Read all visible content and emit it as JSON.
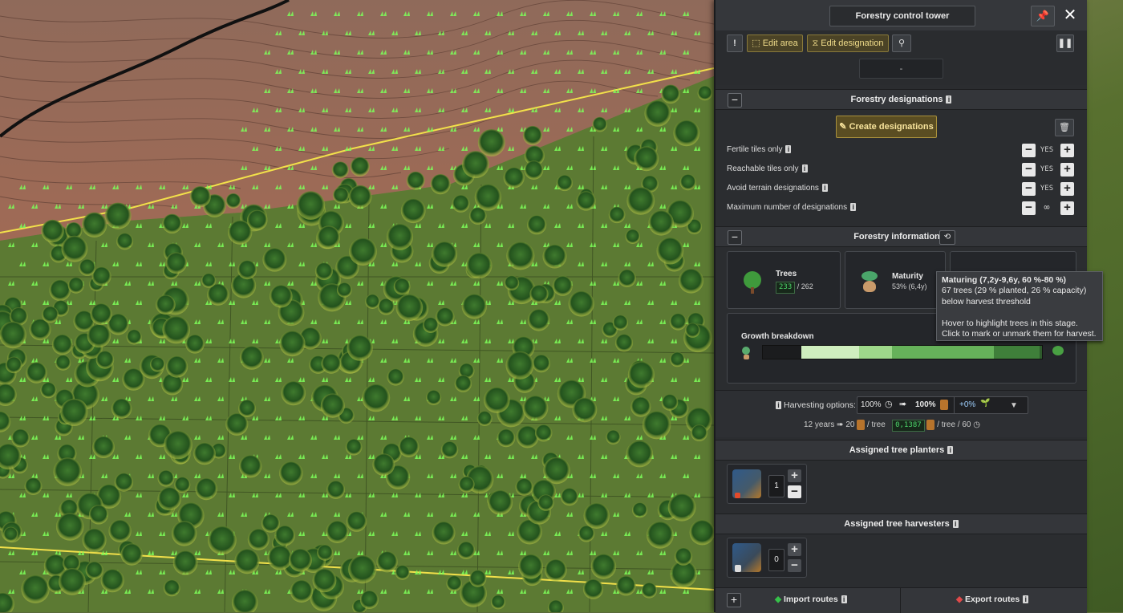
{
  "panel": {
    "title": "Forestry control tower",
    "pin_icon": "pin-icon",
    "close_icon": "close-icon",
    "toolbar": {
      "edit_area_label": "Edit area",
      "edit_designation_label": "Edit designation",
      "selector_value": "-"
    },
    "designations": {
      "title": "Forestry designations",
      "create_label": "Create designations",
      "options": [
        {
          "label": "Fertile tiles only",
          "value": "YES"
        },
        {
          "label": "Reachable tiles only",
          "value": "YES"
        },
        {
          "label": "Avoid terrain designations",
          "value": "YES"
        },
        {
          "label": "Maximum number of designations",
          "value": "∞"
        }
      ]
    },
    "information": {
      "title": "Forestry information",
      "trees_label": "Trees",
      "trees_count": "233",
      "trees_max": "/ 262",
      "maturity_label": "Maturity",
      "maturity_value": "53% (6,4y)",
      "growth_label": "Growth breakdown",
      "growth_segments": [
        {
          "fraction": 0.138,
          "color": "#1b1c1e"
        },
        {
          "fraction": 0.208,
          "color": "#cfeebe"
        },
        {
          "fraction": 0.116,
          "color": "#9ed88a"
        },
        {
          "fraction": 0.365,
          "color": "#66b25a"
        },
        {
          "fraction": 0.165,
          "color": "#3f7f3a"
        },
        {
          "fraction": 0.008,
          "color": "#2e5a2c"
        },
        {
          "fraction": 0.0,
          "color": "#6b3b22"
        }
      ]
    },
    "tooltip": {
      "title": "Maturing (7,2y-9,6y, 60 %-80 %)",
      "line1": "67 trees (29 % planted, 26 % capacity)",
      "line2": "below harvest threshold",
      "line3": "Hover to highlight trees in this stage.",
      "line4": "Click to mark or unmark them for harvest."
    },
    "harvesting": {
      "label": "Harvesting options:",
      "pct1": "100%",
      "pct2": "100%",
      "bonus": "+0%",
      "years": "12 years",
      "per_tree": "20",
      "per_tree_suffix": "/ tree",
      "rate": "0,1387",
      "rate_suffix": "/ tree / 60"
    },
    "planters": {
      "title": "Assigned tree planters",
      "count": "1"
    },
    "harvesters": {
      "title": "Assigned tree harvesters",
      "count": "0"
    },
    "footer": {
      "import_label": "Import routes",
      "export_label": "Export routes"
    }
  },
  "colors": {
    "accent_gold": "#f0dc8a",
    "panel_bg": "#2b2d30",
    "lcd_green": "#4cd56a"
  }
}
